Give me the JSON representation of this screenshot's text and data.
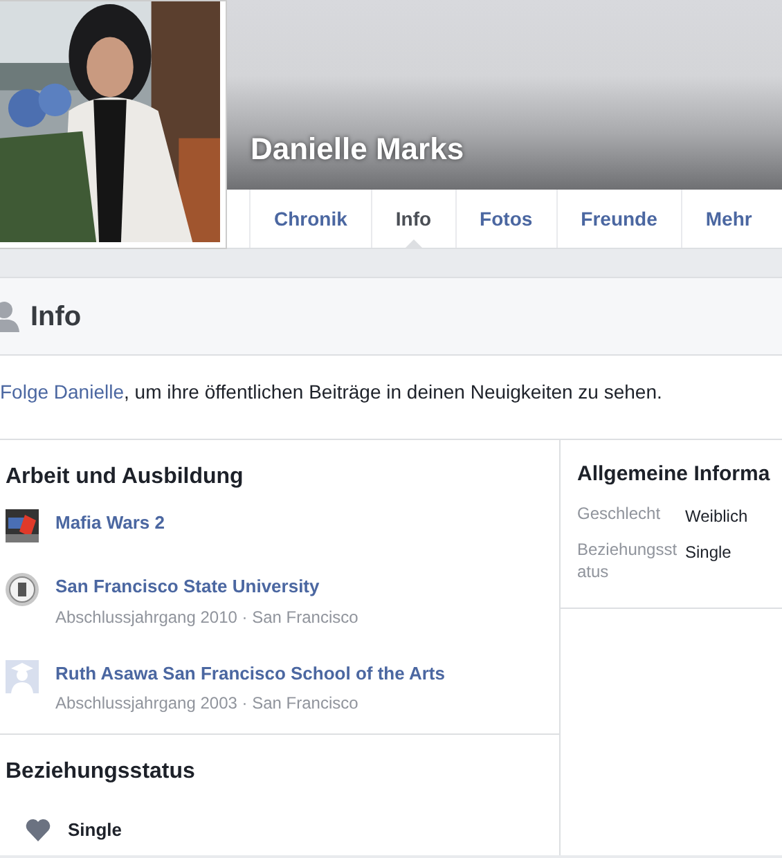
{
  "profile": {
    "name": "Danielle Marks"
  },
  "tabs": [
    {
      "label": "Chronik",
      "selected": false
    },
    {
      "label": "Info",
      "selected": true
    },
    {
      "label": "Fotos",
      "selected": false
    },
    {
      "label": "Freunde",
      "selected": false
    },
    {
      "label": "Mehr",
      "selected": false
    }
  ],
  "section": {
    "title": "Info"
  },
  "follow_notice": {
    "link": "Folge Danielle",
    "text": ", um ihre öffentlichen Beiträge in deinen Neuigkeiten zu sehen."
  },
  "work_education": {
    "title": "Arbeit und Ausbildung",
    "items": [
      {
        "kind": "game",
        "name": "Mafia Wars 2"
      },
      {
        "kind": "seal",
        "name": "San Francisco State University",
        "details": "Abschlussjahrgang 2010 · San Francisco"
      },
      {
        "kind": "graduate",
        "name": "Ruth Asawa San Francisco School of the Arts",
        "details": "Abschlussjahrgang 2003 · San Francisco"
      }
    ]
  },
  "relationship": {
    "title": "Beziehungsstatus",
    "status": "Single"
  },
  "basic_info": {
    "title": "Allgemeine Informa",
    "rows": [
      {
        "label": "Geschlecht",
        "value": "Weiblich"
      },
      {
        "label": "Beziehungsstatus",
        "value": "Single"
      }
    ]
  }
}
